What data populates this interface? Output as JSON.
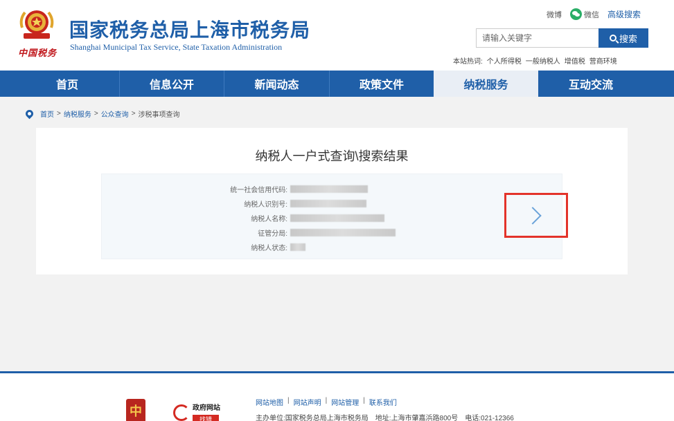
{
  "header": {
    "title_cn": "国家税务总局上海市税务局",
    "title_en": "Shanghai Municipal Tax Service, State Taxation Administration",
    "brand_cursive": "中国税务",
    "links": {
      "weibo": "微博",
      "wechat": "微信",
      "advanced_search": "高级搜索"
    },
    "search": {
      "placeholder": "请输入关键字",
      "button": "搜索"
    },
    "hot": {
      "label": "本站热词:",
      "terms": [
        "个人所得税",
        "一般纳税人",
        "增值税",
        "营商环境"
      ]
    }
  },
  "nav": {
    "items": [
      "首页",
      "信息公开",
      "新闻动态",
      "政策文件",
      "纳税服务",
      "互动交流"
    ],
    "active": "纳税服务"
  },
  "breadcrumb": [
    "首页",
    "纳税服务",
    "公众查询",
    "涉税事项查询"
  ],
  "result": {
    "title": "纳税人一户式查询\\搜索结果",
    "fields": [
      {
        "label": "统一社会信用代码:"
      },
      {
        "label": "纳税人识别号:"
      },
      {
        "label": "纳税人名称:"
      },
      {
        "label": "征管分局:"
      },
      {
        "label": "纳税人状态:"
      }
    ]
  },
  "footer": {
    "links": [
      "网站地图",
      "网站声明",
      "网站管理",
      "联系我们"
    ],
    "gov_site": "政府网站",
    "gov_sub": "找错",
    "host": "主办单位:国家税务总局上海市税务局",
    "address": "地址:上海市肇嘉浜路800号",
    "phone": "电话:021-12366"
  },
  "colors": {
    "brand": "#1f5fa8",
    "highlight": "#e3332a",
    "wechat": "#2aae67"
  }
}
